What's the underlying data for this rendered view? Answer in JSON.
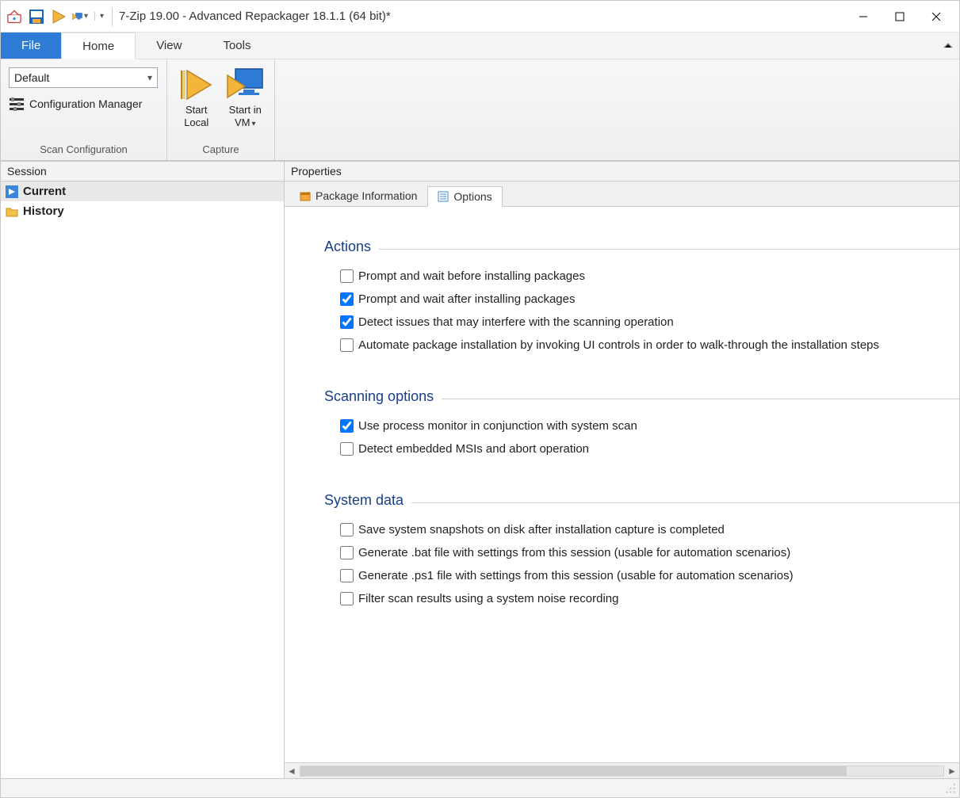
{
  "title": "7-Zip 19.00 - Advanced Repackager 18.1.1 (64 bit)*",
  "ribbon": {
    "tabs": {
      "file": "File",
      "home": "Home",
      "view": "View",
      "tools": "Tools"
    },
    "scan": {
      "combo": "Default",
      "cfgmgr": "Configuration Manager",
      "group": "Scan Configuration"
    },
    "capture": {
      "startLocal1": "Start",
      "startLocal2": "Local",
      "startVM1": "Start in",
      "startVM2": "VM",
      "group": "Capture"
    }
  },
  "sidebar": {
    "header": "Session",
    "current": "Current",
    "history": "History"
  },
  "props": {
    "header": "Properties",
    "tabs": {
      "pkg": "Package Information",
      "opts": "Options"
    },
    "actions": {
      "title": "Actions",
      "o1": "Prompt and wait before installing packages",
      "o2": "Prompt and wait after installing packages",
      "o3": "Detect issues that may interfere with the scanning operation",
      "o4": "Automate package installation by invoking UI controls in order to walk-through the installation steps"
    },
    "scanning": {
      "title": "Scanning options",
      "o1": "Use process monitor in conjunction with system scan",
      "o2": "Detect embedded MSIs and abort operation"
    },
    "sysdata": {
      "title": "System data",
      "o1": "Save system snapshots on disk after installation capture is completed",
      "o2": "Generate .bat file with settings from this session (usable for automation scenarios)",
      "o3": "Generate .ps1 file with settings from this session (usable for automation scenarios)",
      "o4": "Filter scan results using a system noise recording"
    }
  },
  "checks": {
    "actions": [
      false,
      true,
      true,
      false
    ],
    "scanning": [
      true,
      false
    ],
    "sysdata": [
      false,
      false,
      false,
      false
    ]
  }
}
